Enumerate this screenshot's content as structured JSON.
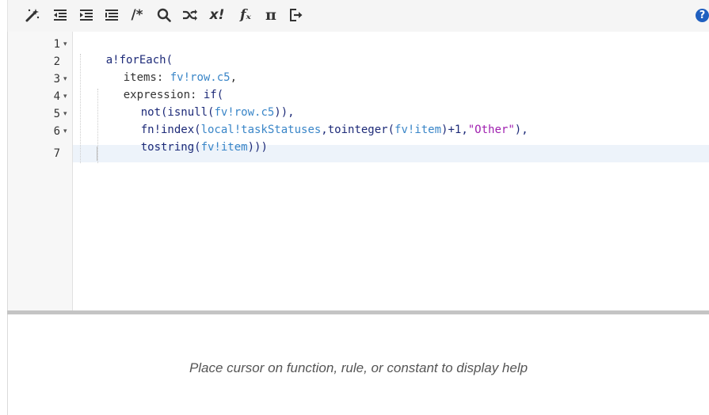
{
  "toolbar": {
    "buttons": [
      {
        "name": "magic-wand-icon"
      },
      {
        "name": "outdent-icon"
      },
      {
        "name": "indent-icon"
      },
      {
        "name": "list-icon"
      },
      {
        "name": "comment-icon",
        "label": "/*"
      },
      {
        "name": "search-icon"
      },
      {
        "name": "shuffle-icon"
      },
      {
        "name": "factorial-icon",
        "label": "x!"
      },
      {
        "name": "function-icon",
        "label": "fₓ"
      },
      {
        "name": "pi-icon",
        "label": "π"
      },
      {
        "name": "exit-icon"
      }
    ],
    "help_label": "?"
  },
  "editor": {
    "lines": [
      {
        "number": "1",
        "fold": "▾"
      },
      {
        "number": "2",
        "fold": ""
      },
      {
        "number": "3",
        "fold": "▾"
      },
      {
        "number": "4",
        "fold": "▾"
      },
      {
        "number": "5",
        "fold": "▾"
      },
      {
        "number": "6",
        "fold": "▾"
      },
      {
        "number": "7",
        "fold": ""
      }
    ],
    "code": {
      "l1": "a!forEach(",
      "l2_key": "items: ",
      "l2_val": "fv!row.c5",
      "l2_end": ",",
      "l3_key": "expression: ",
      "l3_fn": "if(",
      "l4_a": "not(isnull(",
      "l4_var": "fv!row.c5",
      "l4_b": ")),",
      "l5_a": "fn!index(",
      "l5_var1": "local!taskStatuses",
      "l5_b": ",tointeger(",
      "l5_var2": "fv!item",
      "l5_c": ")+1,",
      "l5_str": "\"Other\"",
      "l5_d": "),",
      "l6_a": "tostring(",
      "l6_var": "fv!item",
      "l6_b": ")))"
    }
  },
  "help_panel": {
    "message": "Place cursor on function, rule, or constant to display help"
  },
  "colors": {
    "keyword": "#1d2a78",
    "variable": "#3a86c8",
    "string": "#a020b0",
    "help_button": "#1f5fbf"
  }
}
